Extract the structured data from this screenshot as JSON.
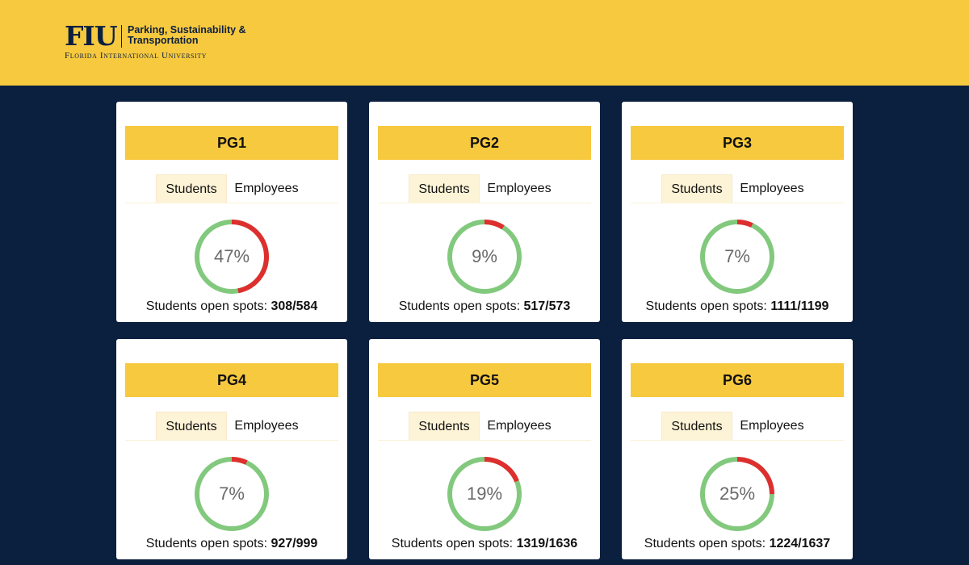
{
  "header": {
    "logo_mark": "FIU",
    "department": "Parking, Sustainability & Transportation",
    "university": "Florida International University"
  },
  "colors": {
    "header_bg": "#f7c93e",
    "page_bg": "#0b1f3f",
    "gauge_available": "#82c97e",
    "gauge_occupied": "#de2f2f"
  },
  "garages": [
    {
      "name": "PG1",
      "tabs": [
        "Students",
        "Employees"
      ],
      "percent_label": "47%",
      "percent": 47,
      "spots_label": "Students open spots:",
      "spots_value": "308/584"
    },
    {
      "name": "PG2",
      "tabs": [
        "Students",
        "Employees"
      ],
      "percent_label": "9%",
      "percent": 9,
      "spots_label": "Students open spots:",
      "spots_value": "517/573"
    },
    {
      "name": "PG3",
      "tabs": [
        "Students",
        "Employees"
      ],
      "percent_label": "7%",
      "percent": 7,
      "spots_label": "Students open spots:",
      "spots_value": "1111/1199"
    },
    {
      "name": "PG4",
      "tabs": [
        "Students",
        "Employees"
      ],
      "percent_label": "7%",
      "percent": 7,
      "spots_label": "Students open spots:",
      "spots_value": "927/999"
    },
    {
      "name": "PG5",
      "tabs": [
        "Students",
        "Employees"
      ],
      "percent_label": "19%",
      "percent": 19,
      "spots_label": "Students open spots:",
      "spots_value": "1319/1636"
    },
    {
      "name": "PG6",
      "tabs": [
        "Students",
        "Employees"
      ],
      "percent_label": "25%",
      "percent": 25,
      "spots_label": "Students open spots:",
      "spots_value": "1224/1637"
    }
  ]
}
